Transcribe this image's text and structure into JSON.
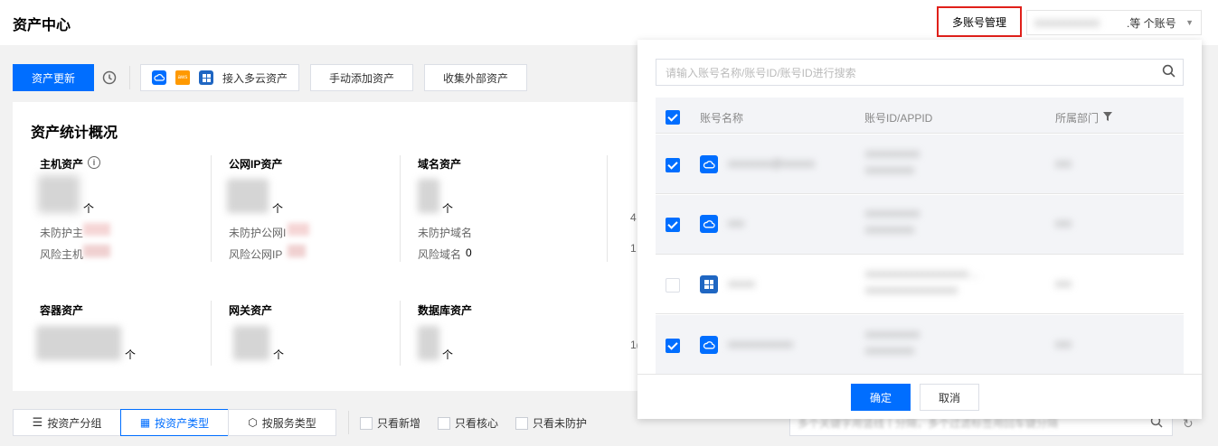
{
  "header": {
    "title": "资产中心",
    "multi_account_label": "多账号管理",
    "account_selector_text": ".等  个账号"
  },
  "toolbar": {
    "update_label": "资产更新",
    "cloud_access_label": "接入多云资产",
    "manual_add_label": "手动添加资产",
    "collect_external_label": "收集外部资产"
  },
  "overview": {
    "title": "资产统计概况",
    "host": {
      "label": "主机资产",
      "unit": "个",
      "unprotected": "未防护主",
      "risk": "风险主机"
    },
    "public_ip": {
      "label": "公网IP资产",
      "unit": "个",
      "unprotected": "未防护公网I",
      "risk": "风险公网IP"
    },
    "domain": {
      "label": "域名资产",
      "unit": "个",
      "unprotected": "未防护域名",
      "risk": "风险域名",
      "risk_value": "0"
    },
    "container": {
      "label": "容器资产",
      "unit": "个"
    },
    "gateway": {
      "label": "网关资产",
      "unit": "个"
    },
    "database": {
      "label": "数据库资产",
      "unit": "个"
    },
    "partial_nums": [
      "4",
      "1",
      "1("
    ]
  },
  "bottom": {
    "by_group": "按资产分组",
    "by_type": "按资产类型",
    "by_service": "按服务类型",
    "only_new": "只看新增",
    "only_core": "只看核心",
    "only_unprotected": "只看未防护",
    "search_placeholder": "多个关键字用竖线丨分隔，多个过滤标签用回车键分隔"
  },
  "panel": {
    "search_placeholder": "请输入账号名称/账号ID/账号ID进行搜索",
    "columns": [
      "账号名称",
      "账号ID/APPID",
      "所属部门"
    ],
    "rows": [
      {
        "checked": true,
        "icon": "cloud",
        "name": "xxxxxxxx@xxxxxx",
        "id": "xxxxxxxxxx",
        "dept": "xxx"
      },
      {
        "checked": true,
        "icon": "cloud",
        "name": "xxx",
        "id": "xxxxxxxxxx",
        "dept": "xxx"
      },
      {
        "checked": false,
        "icon": "microsoft",
        "name": "xxxxx",
        "id": "xxxxxxxxxxxxxxxxxxx…",
        "dept": "xxx"
      },
      {
        "checked": true,
        "icon": "cloud",
        "name": "xxxxxxxxxxxx",
        "id": "xxxxxxxxxx",
        "dept": "xxx"
      }
    ],
    "confirm_label": "确定",
    "cancel_label": "取消"
  },
  "colors": {
    "primary": "#006eff",
    "highlight": "#e0201a"
  }
}
